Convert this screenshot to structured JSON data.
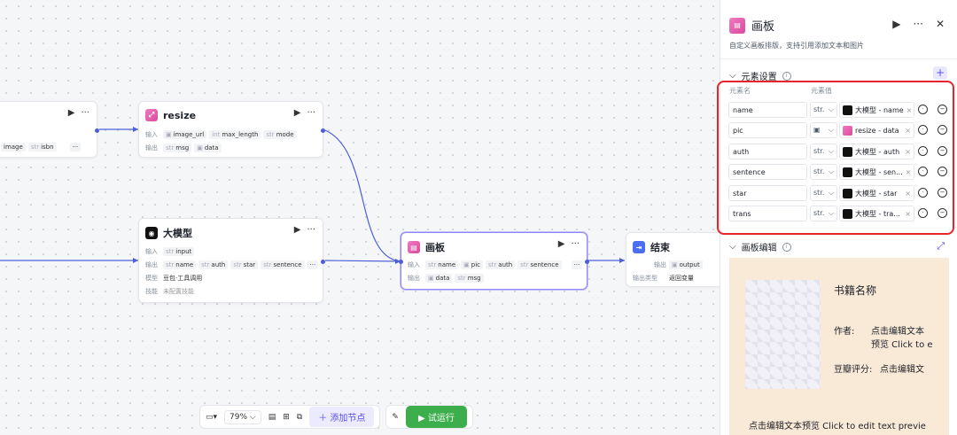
{
  "nodes": {
    "partial": {
      "in_tags": [
        "image",
        "isbn"
      ],
      "more": "···"
    },
    "resize": {
      "title": "resize",
      "in_label": "输入",
      "out_label": "输出",
      "inputs": [
        {
          "t": "img",
          "n": "image_url"
        },
        {
          "t": "int",
          "n": "max_length"
        },
        {
          "t": "str",
          "n": "mode"
        }
      ],
      "outputs": [
        {
          "t": "str",
          "n": "msg"
        },
        {
          "t": "img",
          "n": "data"
        }
      ]
    },
    "llm": {
      "title": "大模型",
      "in_label": "输入",
      "out_label": "输出",
      "model_label": "模型",
      "skill_label": "技能",
      "inputs": [
        {
          "t": "str",
          "n": "input"
        }
      ],
      "outputs": [
        {
          "t": "str",
          "n": "name"
        },
        {
          "t": "str",
          "n": "auth"
        },
        {
          "t": "str",
          "n": "star"
        },
        {
          "t": "str",
          "n": "sentence"
        }
      ],
      "model": "豆包·工具调用",
      "skill": "未配置技能"
    },
    "board": {
      "title": "画板",
      "in_label": "输入",
      "out_label": "输出",
      "inputs": [
        {
          "t": "str",
          "n": "name"
        },
        {
          "t": "img",
          "n": "pic"
        },
        {
          "t": "str",
          "n": "auth"
        },
        {
          "t": "str",
          "n": "sentence"
        }
      ],
      "outputs": [
        {
          "t": "img",
          "n": "data"
        },
        {
          "t": "str",
          "n": "msg"
        }
      ]
    },
    "end": {
      "title": "结束",
      "out_label": "输出",
      "out_type_label": "输出类型",
      "outputs": [
        {
          "t": "img",
          "n": "output"
        }
      ],
      "out_type": "返回变量"
    }
  },
  "panel": {
    "title": "画板",
    "desc": "自定义画板排版，支持引用添加文本和图片",
    "section_elements": "元素设置",
    "col_name": "元素名",
    "col_value": "元素值",
    "elements": [
      {
        "name": "name",
        "type": "str.",
        "ref": "大模型 - name",
        "icon": "llm"
      },
      {
        "name": "pic",
        "type": "▣",
        "ref": "resize - data",
        "icon": "resize"
      },
      {
        "name": "auth",
        "type": "str.",
        "ref": "大模型 - auth",
        "icon": "llm"
      },
      {
        "name": "sentence",
        "type": "str.",
        "ref": "大模型 - sen...",
        "icon": "llm"
      },
      {
        "name": "star",
        "type": "str.",
        "ref": "大模型 - star",
        "icon": "llm"
      },
      {
        "name": "trans",
        "type": "str.",
        "ref": "大模型 - tra...",
        "icon": "llm"
      }
    ],
    "section_canvas": "画板编辑",
    "canvas": {
      "book_title": "书籍名称",
      "author_label": "作者:",
      "author_value": "点击编辑文本",
      "author_value2": "预览 Click to e",
      "rating_label": "豆瓣评分:",
      "rating_value": "点击编辑文",
      "bottom": "点击编辑文本预览 Click to edit text previe"
    }
  },
  "toolbar": {
    "zoom": "79%",
    "add_node": "添加节点",
    "run": "试运行"
  },
  "colors": {
    "accent": "#5a4ff0",
    "run": "#3cae4b",
    "highlight": "#e5252b",
    "edge": "#4c5fd5"
  }
}
